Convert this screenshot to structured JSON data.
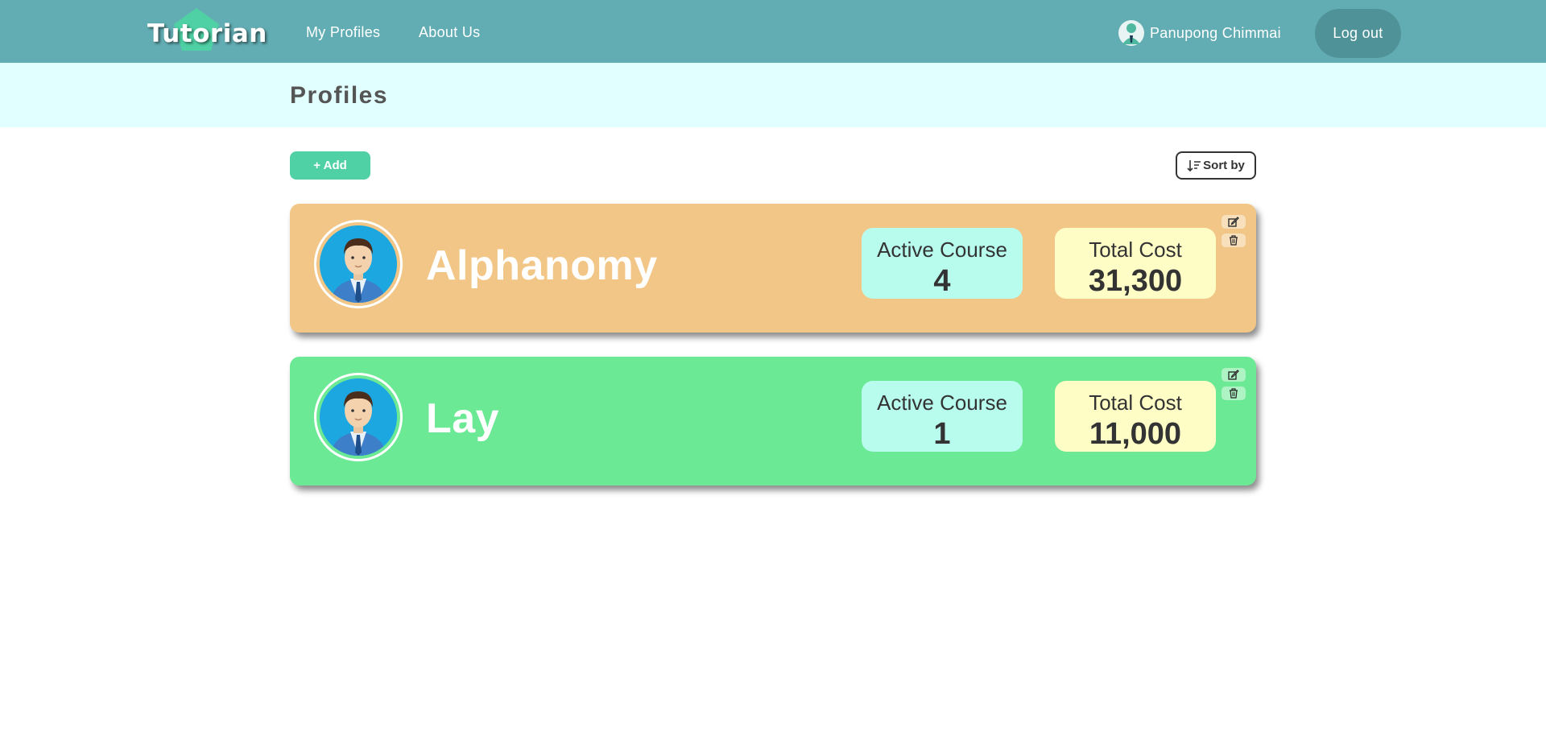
{
  "navbar": {
    "logo_text": "Tutorian",
    "links": [
      {
        "label": "My Profiles"
      },
      {
        "label": "About Us"
      }
    ],
    "user_name": "Panupong Chimmai",
    "logout_label": "Log out"
  },
  "page": {
    "title": "Profiles"
  },
  "toolbar": {
    "add_label": "+ Add",
    "sort_label": "Sort by"
  },
  "profiles": [
    {
      "name": "Alphanomy",
      "active_course_label": "Active Course",
      "active_course": "4",
      "total_cost_label": "Total Cost",
      "total_cost": "31,300",
      "card_color": "#f2c686"
    },
    {
      "name": "Lay",
      "active_course_label": "Active Course",
      "active_course": "1",
      "total_cost_label": "Total Cost",
      "total_cost": "11,000",
      "card_color": "#6ce994"
    }
  ],
  "colors": {
    "navbar": "#62adb3",
    "title_band": "#e0fffe",
    "add_button": "#4fd1a5",
    "logout_button": "#4f9398",
    "active_course_box": "#b8fcee",
    "total_cost_box": "#fffdc6"
  },
  "icons": [
    "user-avatar-icon",
    "sort-icon",
    "edit-icon",
    "trash-icon",
    "profile-avatar-icon"
  ]
}
